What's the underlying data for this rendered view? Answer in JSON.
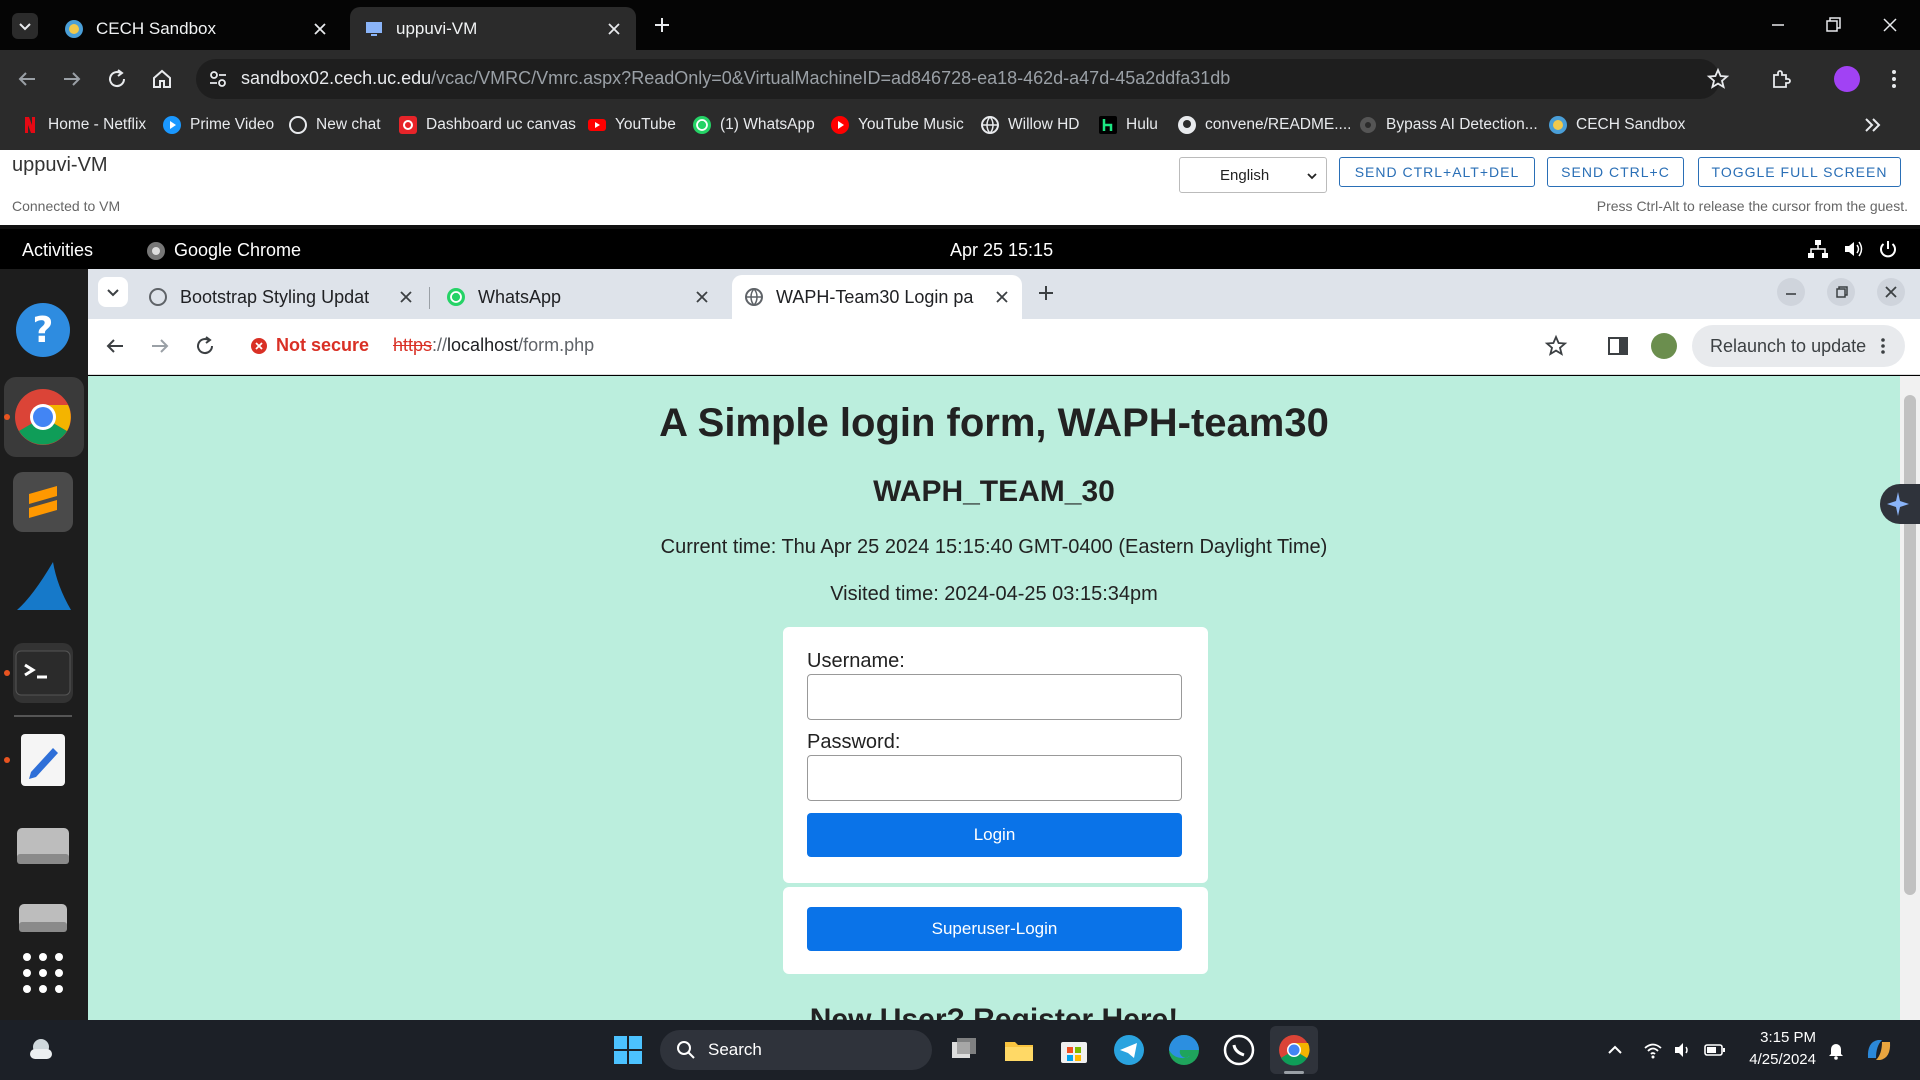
{
  "outer_browser": {
    "tabs": [
      {
        "label": "CECH Sandbox",
        "active": false
      },
      {
        "label": "uppuvi-VM",
        "active": true
      }
    ],
    "url_host": "sandbox02.cech.uc.edu",
    "url_path": "/vcac/VMRC/Vmrc.aspx?ReadOnly=0&VirtualMachineID=ad846728-ea18-462d-a47d-45a2ddfa31db",
    "bookmarks": [
      "Home - Netflix",
      "Prime Video",
      "New chat",
      "Dashboard uc canvas",
      "YouTube",
      "(1) WhatsApp",
      "YouTube Music",
      "Willow HD",
      "Hulu",
      "convene/README....",
      "Bypass AI Detection...",
      "CECH Sandbox"
    ]
  },
  "vmrc": {
    "title": "uppuvi-VM",
    "status": "Connected to VM",
    "language": "English",
    "buttons": [
      "SEND CTRL+ALT+DEL",
      "SEND CTRL+C",
      "TOGGLE FULL SCREEN"
    ],
    "hint": "Press Ctrl-Alt to release the cursor from the guest."
  },
  "ubuntu": {
    "activities": "Activities",
    "app_name": "Google Chrome",
    "clock": "Apr 25  15:15"
  },
  "inner_browser": {
    "tabs": [
      {
        "label": "Bootstrap Styling Updat",
        "active": false
      },
      {
        "label": "WhatsApp",
        "active": false
      },
      {
        "label": "WAPH-Team30 Login pa",
        "active": true
      }
    ],
    "not_secure": "Not secure",
    "url_scheme": "https",
    "url_sep": "://",
    "url_host": "localhost",
    "url_path": "/form.php",
    "relaunch": "Relaunch to update"
  },
  "page": {
    "title": "A Simple login form, WAPH-team30",
    "subtitle": "WAPH_TEAM_30",
    "current_time": "Current time: Thu Apr 25 2024 15:15:40 GMT-0400 (Eastern Daylight Time)",
    "visited_time": "Visited time: 2024-04-25 03:15:34pm",
    "username_label": "Username:",
    "password_label": "Password:",
    "login_button": "Login",
    "superuser_button": "Superuser-Login",
    "register_heading": "New User? Register Here!"
  },
  "taskbar": {
    "search_placeholder": "Search",
    "time": "3:15 PM",
    "date": "4/25/2024"
  }
}
